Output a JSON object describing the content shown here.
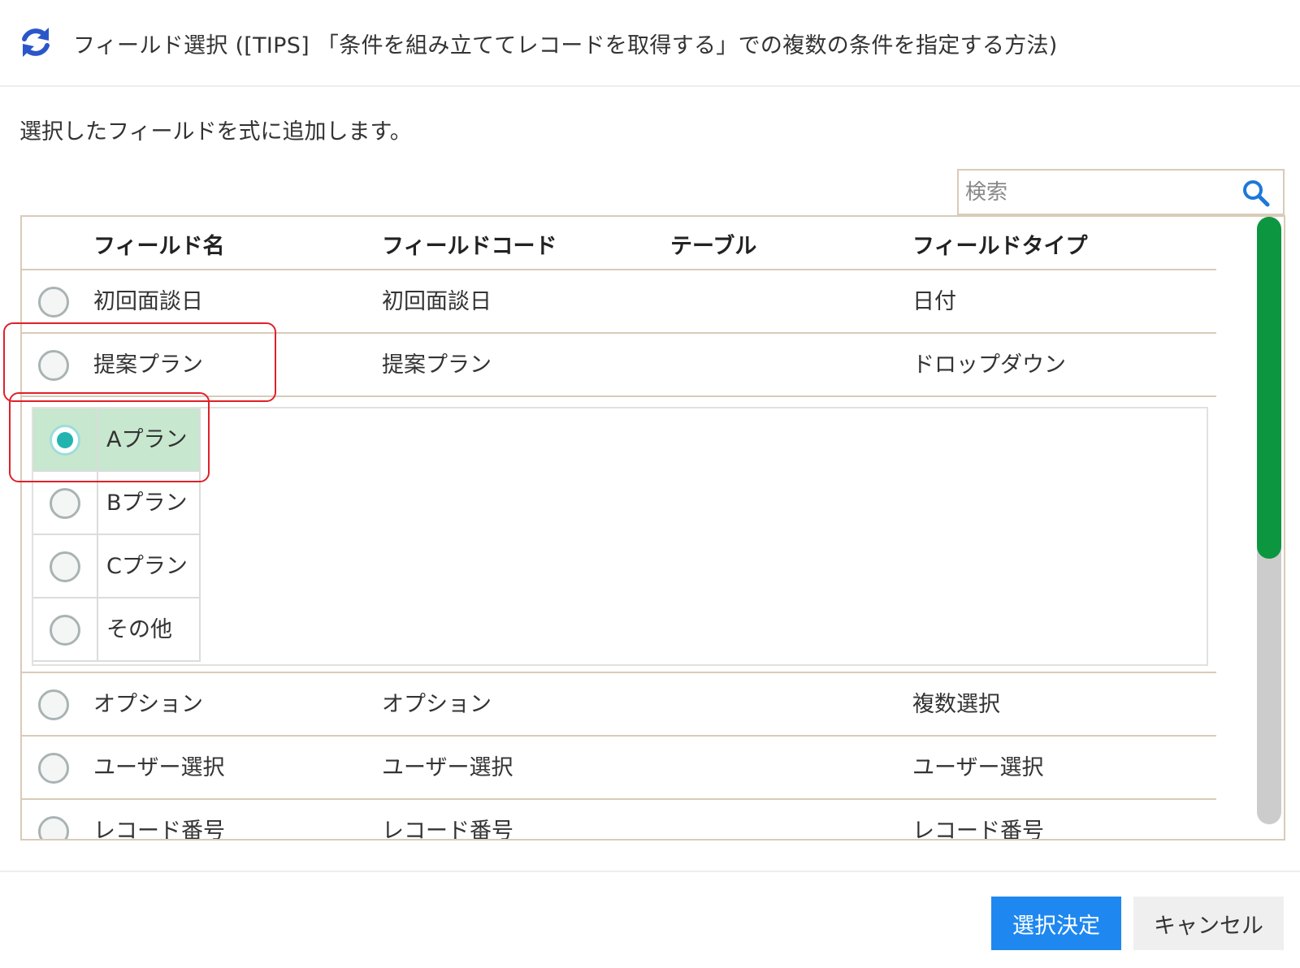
{
  "dialog": {
    "title": "フィールド選択 ([TIPS] 「条件を組み立ててレコードを取得する」での複数の条件を指定する方法)",
    "description": "選択したフィールドを式に追加します。"
  },
  "search": {
    "placeholder": "検索",
    "value": ""
  },
  "table": {
    "columns": [
      "フィールド名",
      "フィールドコード",
      "テーブル",
      "フィールドタイプ"
    ],
    "rows": [
      {
        "name": "初回面談日",
        "code": "初回面談日",
        "table": "",
        "type": "日付",
        "selected": false
      },
      {
        "name": "提案プラン",
        "code": "提案プラン",
        "table": "",
        "type": "ドロップダウン",
        "selected": false
      },
      {
        "name": "オプション",
        "code": "オプション",
        "table": "",
        "type": "複数選択",
        "selected": false
      },
      {
        "name": "ユーザー選択",
        "code": "ユーザー選択",
        "table": "",
        "type": "ユーザー選択",
        "selected": false
      },
      {
        "name": "レコード番号",
        "code": "レコード番号",
        "table": "",
        "type": "レコード番号",
        "selected": false
      }
    ],
    "options": [
      {
        "label": "Aプラン",
        "selected": true
      },
      {
        "label": "Bプラン",
        "selected": false
      },
      {
        "label": "Cプラン",
        "selected": false
      },
      {
        "label": "その他",
        "selected": false
      }
    ]
  },
  "icons": {
    "header": "refresh-icon",
    "search": "search-icon"
  },
  "colors": {
    "accent_blue": "#1e88f0",
    "icon_blue": "#2b56c9",
    "selection_teal": "#23b4b0",
    "selected_row_bg": "#c7e7cf",
    "scroll_thumb": "#0d9640",
    "highlight_red": "#e0202a"
  },
  "buttons": {
    "confirm": "選択決定",
    "cancel": "キャンセル"
  }
}
